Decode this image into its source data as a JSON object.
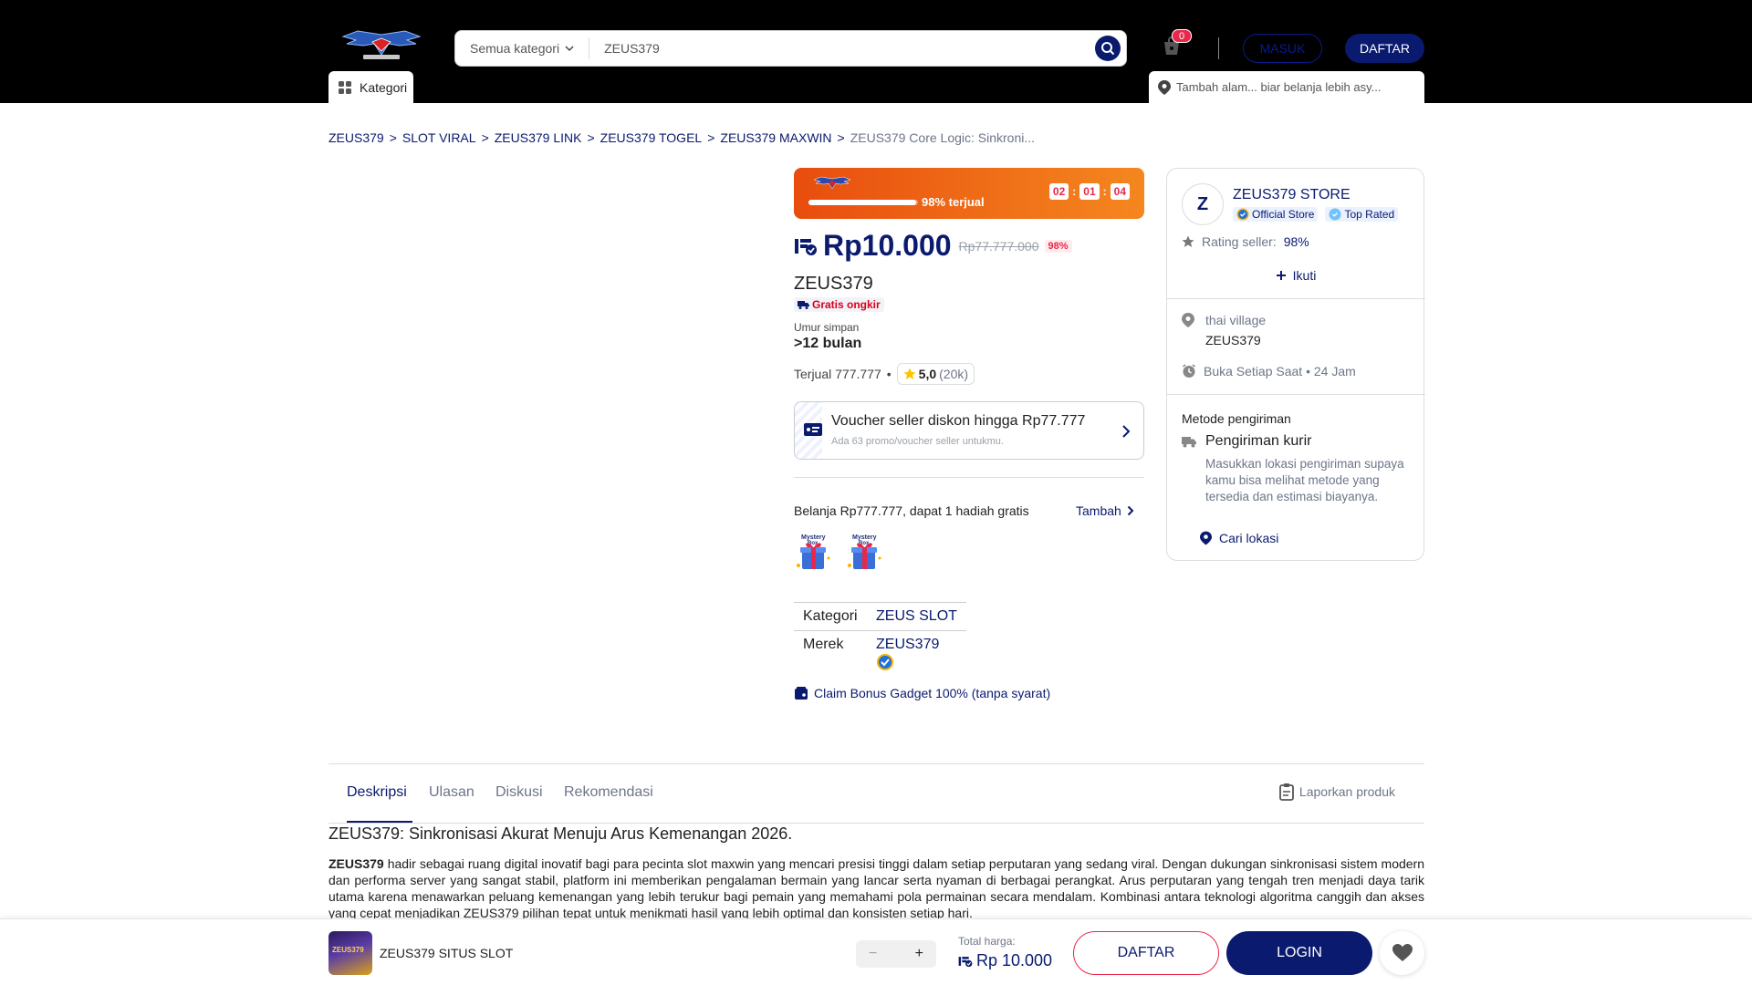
{
  "header": {
    "search": {
      "category": "Semua kategori",
      "value": "ZEUS379"
    },
    "cart_count": "0",
    "masuk_label": "MASUK",
    "daftar_label": "DAFTAR",
    "kategori_label": "Kategori",
    "address_hint": "Tambah alam...  biar belanja lebih asy..."
  },
  "breadcrumb": {
    "items": [
      "ZEUS379",
      "SLOT VIRAL",
      "ZEUS379 LINK",
      "ZEUS379 TOGEL",
      "ZEUS379 MAXWIN"
    ],
    "separator": ">",
    "current": "ZEUS379 Core Logic: Sinkroni..."
  },
  "flash_sale": {
    "sold_label": "98% terjual",
    "sold_fraction": 0.98,
    "timer": {
      "h": "02",
      "m": "01",
      "s": "04",
      "sep": ":"
    }
  },
  "product": {
    "price": "Rp10.000",
    "old_price": "Rp77.777.000",
    "discount": "98%",
    "name": "ZEUS379",
    "free_shipping": "Gratis ongkir",
    "umur_label": "Umur simpan",
    "umur_value": ">12 bulan",
    "sold": "Terjual 777.777",
    "dot": "•",
    "rating": "5,0",
    "rating_count": "(20k)"
  },
  "voucher": {
    "title": "Voucher seller diskon hingga Rp77.777",
    "subtitle": "Ada 63 promo/voucher seller untukmu."
  },
  "gift": {
    "label": "Belanja Rp777.777, dapat 1 hadiah gratis",
    "tambah": "Tambah",
    "box_text": "Mystery Box"
  },
  "specs": {
    "rows": [
      {
        "key": "Kategori",
        "value": "ZEUS SLOT"
      },
      {
        "key": "Merek",
        "value": "ZEUS379"
      }
    ]
  },
  "claim": "Claim Bonus Gadget 100% (tanpa syarat)",
  "seller": {
    "initial": "Z",
    "name": "ZEUS379 STORE",
    "official": "Official Store",
    "top": "Top Rated",
    "rating_label": "Rating seller:",
    "rating_value": "98%",
    "follow": "Ikuti",
    "location1": "thai village",
    "location2": "ZEUS379",
    "open": "Buka Setiap Saat • 24 Jam",
    "shipping_label": "Metode pengiriman",
    "kurir": "Pengiriman kurir",
    "kurir_desc": "Masukkan lokasi pengiriman supaya kamu bisa melihat metode yang tersedia dan estimasi biayanya.",
    "cari": "Cari lokasi"
  },
  "tabs": {
    "items": [
      "Deskripsi",
      "Ulasan",
      "Diskusi",
      "Rekomendasi"
    ],
    "report": "Laporkan produk"
  },
  "description": {
    "title": "ZEUS379: Sinkronisasi Akurat Menuju Arus Kemenangan 2026.",
    "lead": "ZEUS379",
    "body": " hadir sebagai ruang digital inovatif bagi para pecinta slot maxwin yang mencari presisi tinggi dalam setiap perputaran yang sedang viral. Dengan dukungan sinkronisasi sistem modern dan performa server yang sangat stabil, platform ini memberikan pengalaman bermain yang lancar serta nyaman di berbagai perangkat. Arus perputaran yang tengah tren menjadi daya tarik utama karena menawarkan peluang kemenangan yang lebih terukur bagi pemain yang memahami pola permainan secara mendalam. Kombinasi antara teknologi algoritma canggih dan akses yang cepat menjadikan ZEUS379 pilihan tepat untuk menikmati hasil yang lebih optimal dan konsisten setiap hari."
  },
  "bottom_bar": {
    "thumb_text": "ZEUS379",
    "name": "ZEUS379 SITUS SLOT",
    "minus": "−",
    "plus": "+",
    "total_label": "Total harga:",
    "total_value": "Rp 10.000",
    "daftar": "DAFTAR",
    "login": "LOGIN"
  },
  "colors": {
    "primary": "#0a1a6e",
    "accent": "#e8284a",
    "flash_start": "#e84d0e",
    "flash_end": "#f5871f"
  }
}
